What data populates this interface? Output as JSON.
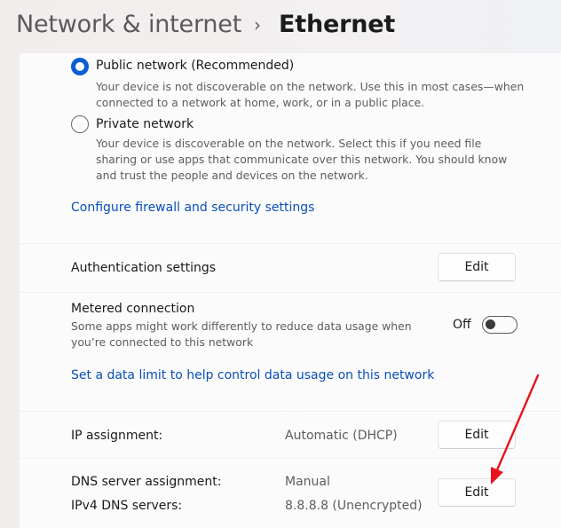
{
  "header": {
    "parent": "Network & internet",
    "separator": "›",
    "current": "Ethernet"
  },
  "network_profile": {
    "options": [
      {
        "title": "Public network (Recommended)",
        "description": "Your device is not discoverable on the network. Use this in most cases—when connected to a network at home, work, or in a public place.",
        "selected": true
      },
      {
        "title": "Private network",
        "description": "Your device is discoverable on the network. Select this if you need file sharing or use apps that communicate over this network. You should know and trust the people and devices on the network.",
        "selected": false
      }
    ],
    "firewall_link": "Configure firewall and security settings"
  },
  "authentication": {
    "label": "Authentication settings",
    "button": "Edit"
  },
  "metered": {
    "label": "Metered connection",
    "description": "Some apps might work differently to reduce data usage when you’re connected to this network",
    "state_text": "Off",
    "enabled": false,
    "data_limit_link": "Set a data limit to help control data usage on this network"
  },
  "ip": {
    "label": "IP assignment:",
    "value": "Automatic (DHCP)",
    "button": "Edit"
  },
  "dns": {
    "label": "DNS server assignment:",
    "value": "Manual",
    "ipv4_label": "IPv4 DNS servers:",
    "ipv4_value": "8.8.8.8 (Unencrypted)",
    "button": "Edit"
  },
  "colors": {
    "accent": "#0a5fd6",
    "link": "#0a4fb8",
    "annotation_arrow": "#e8141c"
  }
}
